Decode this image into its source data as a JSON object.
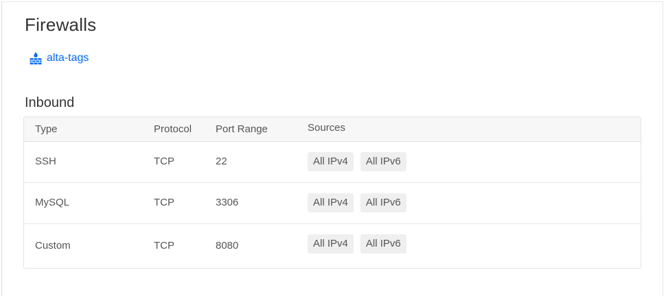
{
  "page": {
    "title": "Firewalls"
  },
  "firewall": {
    "name": "alta-tags",
    "icon": "firewall-icon",
    "link_color": "#0069ff"
  },
  "inbound": {
    "title": "Inbound",
    "columns": {
      "type": "Type",
      "protocol": "Protocol",
      "port_range": "Port Range",
      "sources": "Sources"
    },
    "rows": [
      {
        "type": "SSH",
        "protocol": "TCP",
        "port_range": "22",
        "sources": [
          "All IPv4",
          "All IPv6"
        ]
      },
      {
        "type": "MySQL",
        "protocol": "TCP",
        "port_range": "3306",
        "sources": [
          "All IPv4",
          "All IPv6"
        ]
      },
      {
        "type": "Custom",
        "protocol": "TCP",
        "port_range": "8080",
        "sources": [
          "All IPv4",
          "All IPv6"
        ]
      }
    ]
  }
}
